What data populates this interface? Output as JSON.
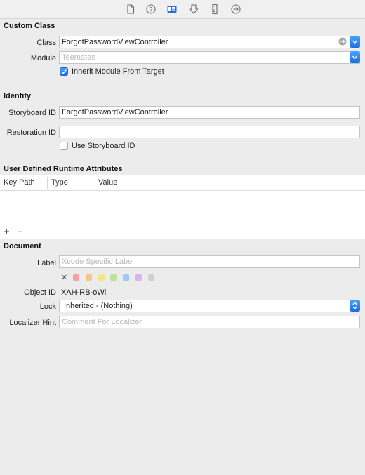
{
  "toolbar": {
    "icons": [
      "file-inspector-icon",
      "quick-help-icon",
      "identity-inspector-icon",
      "attributes-inspector-icon",
      "size-inspector-icon",
      "connections-inspector-icon"
    ]
  },
  "custom_class": {
    "title": "Custom Class",
    "class_label": "Class",
    "class_value": "ForgotPasswordViewController",
    "module_label": "Module",
    "module_placeholder": "Teemates",
    "inherit_label": "Inherit Module From Target",
    "inherit_checked": true
  },
  "identity": {
    "title": "Identity",
    "storyboard_id_label": "Storyboard ID",
    "storyboard_id_value": "ForgotPasswordViewController",
    "restoration_id_label": "Restoration ID",
    "restoration_id_value": "",
    "use_storyboard_id_label": "Use Storyboard ID",
    "use_storyboard_id_checked": false
  },
  "runtime_attributes": {
    "title": "User Defined Runtime Attributes",
    "columns": [
      "Key Path",
      "Type",
      "Value"
    ],
    "rows": [],
    "add_symbol": "+",
    "remove_symbol": "−"
  },
  "document": {
    "title": "Document",
    "label_label": "Label",
    "label_placeholder": "Xcode Specific Label",
    "clear_symbol": "✕",
    "label_colors": [
      "#f4a3a3",
      "#f7c589",
      "#f3e58a",
      "#bfe09a",
      "#9fc9f2",
      "#d9b3ee",
      "#cfcfcf"
    ],
    "object_id_label": "Object ID",
    "object_id_value": "XAH-RB-oWi",
    "lock_label": "Lock",
    "lock_value": "Inherited - (Nothing)",
    "localizer_label": "Localizer Hint",
    "localizer_placeholder": "Comment For Localizer"
  },
  "colors": {
    "accent": "#1f73e3",
    "background": "#ececec"
  }
}
